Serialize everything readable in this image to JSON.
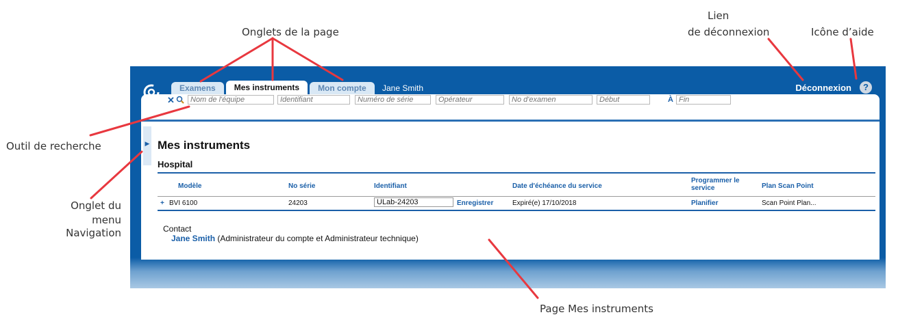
{
  "callouts": {
    "page_tabs": "Onglets de la page",
    "logout_link_1": "Lien",
    "logout_link_2": "de déconnexion",
    "help_icon": "Icône d’aide",
    "search_tool": "Outil de recherche",
    "nav_tab_1": "Onglet du",
    "nav_tab_2": "menu Navigation",
    "instruments_page": "Page Mes instruments"
  },
  "tabs": [
    "Examens",
    "Mes instruments",
    "Mon compte"
  ],
  "user_name": "Jane Smith",
  "logout": "Déconnexion",
  "help_glyph": "?",
  "search": {
    "clear_glyph": "✕",
    "placeholders": {
      "team": "Nom de l'équipe",
      "identifier": "Identifiant",
      "serial": "Numéro de série",
      "operator": "Opérateur",
      "exam_no": "No d'examen",
      "start": "Début",
      "to": "À",
      "end": "Fin"
    }
  },
  "page_title": "Mes instruments",
  "group_name": "Hospital",
  "table": {
    "headers": {
      "model": "Modèle",
      "serial": "No série",
      "identifier": "Identifiant",
      "service_due": "Date d'échéance du service",
      "schedule": "Programmer le service",
      "plan": "Plan Scan Point"
    },
    "rows": [
      {
        "expand": "+",
        "model": "BVI 6100",
        "serial": "24203",
        "identifier": "ULab-24203",
        "save": "Enregistrer",
        "service_due": "Expiré(e) 17/10/2018",
        "schedule": "Planifier",
        "plan": "Scan Point Plan..."
      }
    ]
  },
  "contact": {
    "label": "Contact",
    "name": "Jane Smith",
    "role": "(Administrateur du compte et Administrateur technique)"
  },
  "colors": {
    "primary_blue": "#0b5ca6",
    "link_blue": "#1a5fa8",
    "callout_red": "#e8383f"
  }
}
